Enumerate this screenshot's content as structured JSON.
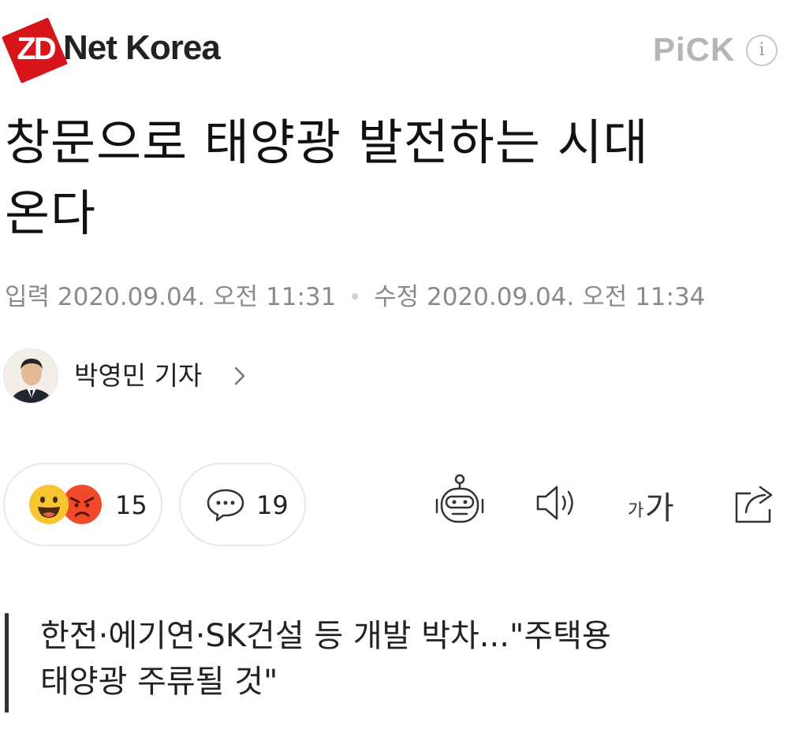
{
  "header": {
    "logo_badge": "ZD",
    "logo_text": "Net Korea",
    "pick_label": "PiCK",
    "info_icon": "i"
  },
  "article": {
    "title_line1": "창문으로 태양광 발전하는 시대",
    "title_line2": "온다",
    "input_label": "입력",
    "input_datetime": "2020.09.04. 오전 11:31",
    "edit_label": "수정",
    "edit_datetime": "2020.09.04. 오전 11:34",
    "subtitle_line1": "한전·에기연·SK건설 등 개발 박차...\"주택용",
    "subtitle_line2": "태양광 주류될 것\""
  },
  "reporter": {
    "name": "박영민 기자"
  },
  "actions": {
    "reaction_count": "15",
    "comment_count": "19",
    "font_small": "가",
    "font_big": "가"
  },
  "icons": [
    "info-icon",
    "happy-emoji-icon",
    "angry-emoji-icon",
    "comment-icon",
    "robot-icon",
    "speaker-icon",
    "font-size-icon",
    "share-icon",
    "chevron-right-icon"
  ],
  "colors": {
    "logo_red": "#d7141a",
    "pick_gray": "#b5b5b5",
    "meta_gray": "#8a8a8a",
    "happy_yellow": "#f7c531",
    "angry_red": "#f04a2a"
  }
}
